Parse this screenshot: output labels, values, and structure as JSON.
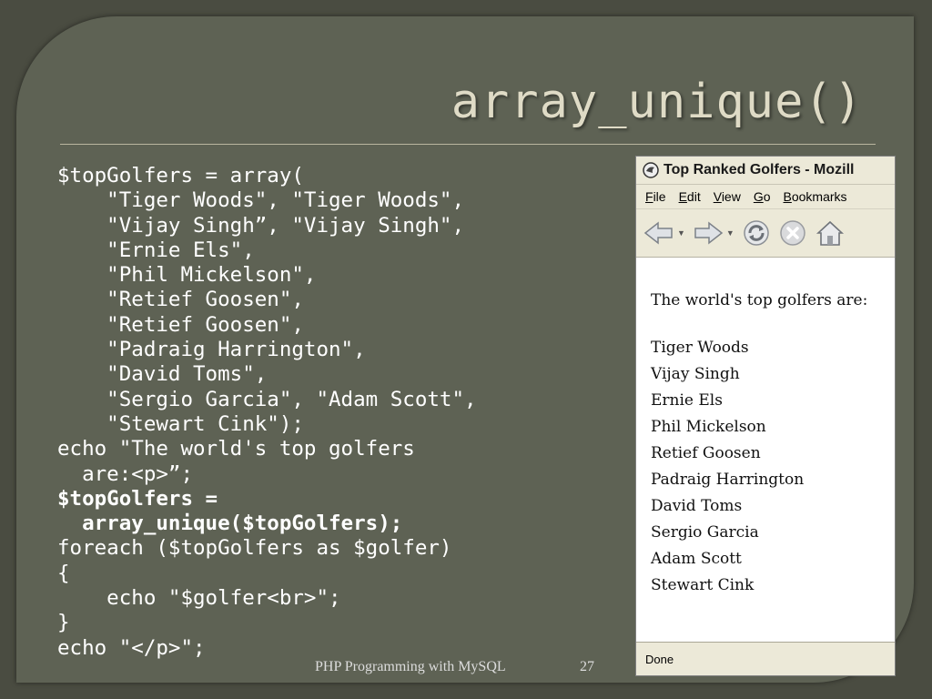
{
  "slide": {
    "title": "array_unique()",
    "code_lines": [
      {
        "text": "$topGolfers = array(",
        "bold": false
      },
      {
        "text": "    \"Tiger Woods\", \"Tiger Woods\",",
        "bold": false
      },
      {
        "text": "    \"Vijay Singh”, \"Vijay Singh\",",
        "bold": false
      },
      {
        "text": "    \"Ernie Els\",",
        "bold": false
      },
      {
        "text": "    \"Phil Mickelson\",",
        "bold": false
      },
      {
        "text": "    \"Retief Goosen\",",
        "bold": false
      },
      {
        "text": "    \"Retief Goosen\",",
        "bold": false
      },
      {
        "text": "    \"Padraig Harrington\",",
        "bold": false
      },
      {
        "text": "    \"David Toms\",",
        "bold": false
      },
      {
        "text": "    \"Sergio Garcia\", \"Adam Scott\",",
        "bold": false
      },
      {
        "text": "    \"Stewart Cink\");",
        "bold": false
      },
      {
        "text": "echo \"The world's top golfers",
        "bold": false
      },
      {
        "text": "  are:<p>”;",
        "bold": false
      },
      {
        "text": "$topGolfers =",
        "bold": true
      },
      {
        "text": "  array_unique($topGolfers);",
        "bold": true
      },
      {
        "text": "foreach ($topGolfers as $golfer)",
        "bold": false
      },
      {
        "text": "{",
        "bold": false
      },
      {
        "text": "    echo \"$golfer<br>\";",
        "bold": false
      },
      {
        "text": "}",
        "bold": false
      },
      {
        "text": "echo \"</p>\";",
        "bold": false
      }
    ],
    "footer": "PHP Programming with MySQL",
    "page_number": "27"
  },
  "browser": {
    "window_title": "Top Ranked Golfers - Mozill",
    "menu": [
      {
        "u": "F",
        "rest": "ile"
      },
      {
        "u": "E",
        "rest": "dit"
      },
      {
        "u": "V",
        "rest": "iew"
      },
      {
        "u": "G",
        "rest": "o"
      },
      {
        "u": "B",
        "rest": "ookmarks"
      }
    ],
    "toolbar_icons": [
      "back-arrow-icon",
      "forward-arrow-icon",
      "reload-icon",
      "stop-icon",
      "home-icon"
    ],
    "intro_text": "The world's top golfers are:",
    "golfers": [
      "Tiger Woods",
      "Vijay Singh",
      "Ernie Els",
      "Phil Mickelson",
      "Retief Goosen",
      "Padraig Harrington",
      "David Toms",
      "Sergio Garcia",
      "Adam Scott",
      "Stewart Cink"
    ],
    "status": "Done"
  },
  "colors": {
    "slide_bg": "#5e6254",
    "outer_bg": "#4a4c41",
    "title": "#dfdbc6",
    "code_text": "#ffffff"
  }
}
